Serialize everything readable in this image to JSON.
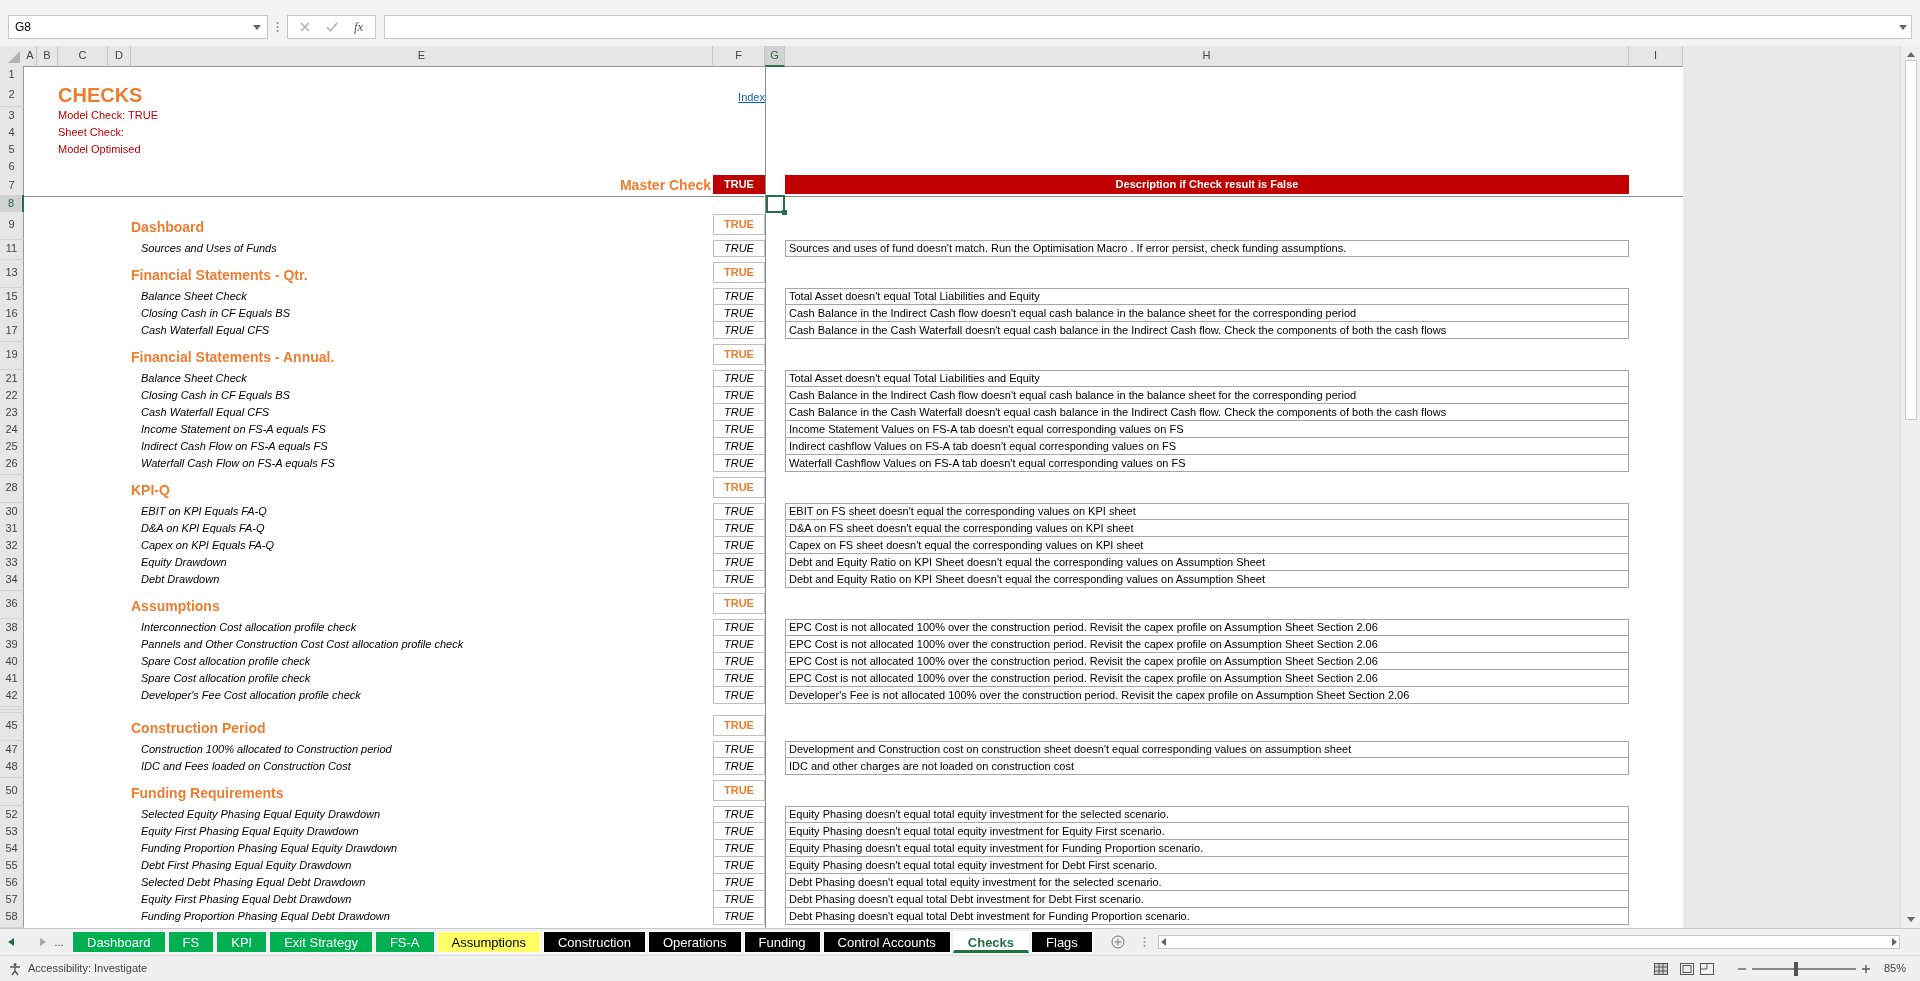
{
  "formula_bar": {
    "name_box": "G8",
    "function_label": "fx"
  },
  "columns": [
    {
      "label": "A",
      "selected": false
    },
    {
      "label": "B",
      "selected": false
    },
    {
      "label": "C",
      "selected": false
    },
    {
      "label": "D",
      "selected": false
    },
    {
      "label": "E",
      "selected": false
    },
    {
      "label": "F",
      "selected": false
    },
    {
      "label": "G",
      "selected": true
    },
    {
      "label": "H",
      "selected": false
    },
    {
      "label": "I",
      "selected": false
    }
  ],
  "top_rows": [
    {
      "label": "1",
      "selected": false
    },
    {
      "label": "2",
      "selected": false
    },
    {
      "label": "3",
      "selected": false
    },
    {
      "label": "4",
      "selected": false
    },
    {
      "label": "5",
      "selected": false
    },
    {
      "label": "6",
      "selected": false
    },
    {
      "label": "7",
      "selected": false
    },
    {
      "label": "8",
      "selected": true
    }
  ],
  "header": {
    "title": "CHECKS",
    "lines": [
      "Model Check: TRUE",
      "Sheet Check:",
      "Model Optimised"
    ],
    "link": "Index",
    "master_label": "Master Check",
    "master_value": "TRUE",
    "description_header": "Description if Check result is False"
  },
  "sections": [
    {
      "row": "9",
      "title": "Dashboard",
      "result": "TRUE",
      "items": [
        {
          "row": "11",
          "label": "Sources and Uses of Funds",
          "result": "TRUE",
          "description": "Sources and uses of fund doesn't match. Run the Optimisation Macro . If error persist, check funding assumptions."
        }
      ]
    },
    {
      "row": "13",
      "title": "Financial Statements - Qtr.",
      "result": "TRUE",
      "items": [
        {
          "row": "15",
          "label": "Balance Sheet Check",
          "result": "TRUE",
          "description": "Total Asset doesn't equal Total Liabilities and Equity"
        },
        {
          "row": "16",
          "label": "Closing Cash in CF Equals BS",
          "result": "TRUE",
          "description": "Cash Balance in the Indirect Cash flow doesn't equal cash balance in the balance sheet for the corresponding period"
        },
        {
          "row": "17",
          "label": "Cash Waterfall Equal CFS",
          "result": "TRUE",
          "description": "Cash Balance in the Cash Waterfall doesn't equal cash balance in the Indirect Cash flow. Check the components of both the cash flows"
        }
      ]
    },
    {
      "row": "19",
      "title": "Financial Statements - Annual.",
      "result": "TRUE",
      "items": [
        {
          "row": "21",
          "label": "Balance Sheet Check",
          "result": "TRUE",
          "description": "Total Asset doesn't equal Total Liabilities and Equity"
        },
        {
          "row": "22",
          "label": "Closing Cash in CF Equals BS",
          "result": "TRUE",
          "description": "Cash Balance in the Indirect Cash flow doesn't equal cash balance in the balance sheet for the corresponding period"
        },
        {
          "row": "23",
          "label": "Cash Waterfall Equal CFS",
          "result": "TRUE",
          "description": "Cash Balance in the Cash Waterfall doesn't equal cash balance in the Indirect Cash flow. Check the components of both the cash flows"
        },
        {
          "row": "24",
          "label": "Income Statement on FS-A equals FS",
          "result": "TRUE",
          "description": "Income Statement Values on FS-A tab doesn't equal corresponding values on FS"
        },
        {
          "row": "25",
          "label": "Indirect Cash Flow on FS-A equals FS",
          "result": "TRUE",
          "description": "Indirect cashflow Values on FS-A tab doesn't equal corresponding values on FS"
        },
        {
          "row": "26",
          "label": "Waterfall Cash Flow on FS-A equals FS",
          "result": "TRUE",
          "description": "Waterfall Cashflow Values on FS-A tab doesn't equal corresponding values on FS"
        }
      ]
    },
    {
      "row": "28",
      "title": "KPI-Q",
      "result": "TRUE",
      "items": [
        {
          "row": "30",
          "label": "EBIT on KPI Equals FA-Q",
          "result": "TRUE",
          "description": "EBIT on FS sheet doesn't equal the corresponding values on KPI sheet"
        },
        {
          "row": "31",
          "label": "D&A on KPI Equals FA-Q",
          "result": "TRUE",
          "description": "D&A on FS sheet doesn't equal the corresponding values on KPI sheet"
        },
        {
          "row": "32",
          "label": "Capex on KPI Equals FA-Q",
          "result": "TRUE",
          "description": "Capex on FS sheet doesn't equal the corresponding values on KPI sheet"
        },
        {
          "row": "33",
          "label": "Equity Drawdown",
          "result": "TRUE",
          "description": "Debt and Equity Ratio on KPI Sheet doesn't equal the corresponding values on Assumption Sheet"
        },
        {
          "row": "34",
          "label": "Debt Drawdown",
          "result": "TRUE",
          "description": "Debt and Equity Ratio on KPI Sheet doesn't equal the corresponding values on Assumption Sheet"
        }
      ]
    },
    {
      "row": "36",
      "title": "Assumptions",
      "result": "TRUE",
      "items": [
        {
          "row": "38",
          "label": "Interconnection Cost allocation profile check",
          "result": "TRUE",
          "description": "EPC Cost is not allocated 100% over the construction period. Revisit the capex profile on Assumption Sheet Section 2.06"
        },
        {
          "row": "39",
          "label": "Pannels and Other Construction Cost Cost allocation profile check",
          "result": "TRUE",
          "description": "EPC Cost is not allocated 100% over the construction period. Revisit the capex profile on Assumption Sheet Section 2.06"
        },
        {
          "row": "40",
          "label": "Spare Cost allocation profile check",
          "result": "TRUE",
          "description": "EPC Cost is not allocated 100% over the construction period. Revisit the capex profile on Assumption Sheet Section 2.06"
        },
        {
          "row": "41",
          "label": "Spare Cost allocation profile check",
          "result": "TRUE",
          "description": "EPC Cost is not allocated 100% over the construction period. Revisit the capex profile on Assumption Sheet Section 2.06"
        },
        {
          "row": "42",
          "label": "Developer's Fee Cost allocation profile check",
          "result": "TRUE",
          "description": "Developer's Fee is not allocated 100% over the construction period. Revisit the capex profile on Assumption Sheet Section 2.06"
        }
      ]
    },
    {
      "row": "45",
      "title": "Construction Period",
      "result": "TRUE",
      "items": [
        {
          "row": "47",
          "label": "Construction 100% allocated to Construction period",
          "result": "TRUE",
          "description": "Development and Construction cost on construction sheet doesn't equal corresponding values on assumption sheet"
        },
        {
          "row": "48",
          "label": "IDC and Fees loaded on Construction Cost",
          "result": "TRUE",
          "description": "IDC and other charges are not loaded on construction cost"
        }
      ]
    },
    {
      "row": "50",
      "title": "Funding Requirements",
      "result": "TRUE",
      "items": [
        {
          "row": "52",
          "label": "Selected Equity Phasing Equal Equity Drawdown",
          "result": "TRUE",
          "description": "Equity Phasing doesn't equal total equity investment for the selected scenario."
        },
        {
          "row": "53",
          "label": "Equity First Phasing Equal Equity Drawdown",
          "result": "TRUE",
          "description": "Equity Phasing doesn't equal total equity investment for Equity First scenario."
        },
        {
          "row": "54",
          "label": "Funding Proportion Phasing Equal Equity Drawdown",
          "result": "TRUE",
          "description": "Equity Phasing doesn't equal total equity investment for Funding Proportion scenario."
        },
        {
          "row": "55",
          "label": "Debt First Phasing Equal Equity Drawdown",
          "result": "TRUE",
          "description": "Equity Phasing doesn't equal total equity investment for Debt First scenario."
        },
        {
          "row": "56",
          "label": "Selected Debt Phasing Equal Debt Drawdown",
          "result": "TRUE",
          "description": "Debt Phasing doesn't equal total equity investment for the selected scenario."
        },
        {
          "row": "57",
          "label": "Equity First Phasing Equal Debt Drawdown",
          "result": "TRUE",
          "description": "Debt Phasing doesn't equal total Debt investment for Debt First scenario."
        },
        {
          "row": "58",
          "label": "Funding Proportion Phasing Equal Debt Drawdown",
          "result": "TRUE",
          "description": "Debt Phasing doesn't equal total Debt investment for Funding Proportion scenario."
        }
      ]
    }
  ],
  "sheet_tabs": {
    "more": "...",
    "tabs": [
      {
        "label": "Dashboard",
        "color": "#00b050",
        "selected": false
      },
      {
        "label": "FS",
        "color": "#00b050",
        "selected": false
      },
      {
        "label": "KPI",
        "color": "#00b050",
        "selected": false
      },
      {
        "label": "Exit Strategy",
        "color": "#00b050",
        "selected": false
      },
      {
        "label": "FS-A",
        "color": "#00b050",
        "selected": false
      },
      {
        "label": "Assumptions",
        "color": "#ffff66",
        "selected": false
      },
      {
        "label": "Construction",
        "color": "#000000",
        "selected": false
      },
      {
        "label": "Operations",
        "color": "#000000",
        "selected": false
      },
      {
        "label": "Funding",
        "color": "#000000",
        "selected": false
      },
      {
        "label": "Control Accounts",
        "color": "#000000",
        "selected": false
      },
      {
        "label": "Checks",
        "selected": true
      },
      {
        "label": "Flags",
        "color": "#000000",
        "selected": false
      }
    ]
  },
  "status_bar": {
    "accessibility": "Accessibility: Investigate",
    "zoom": {
      "level": 0.42,
      "label": "85%"
    }
  }
}
